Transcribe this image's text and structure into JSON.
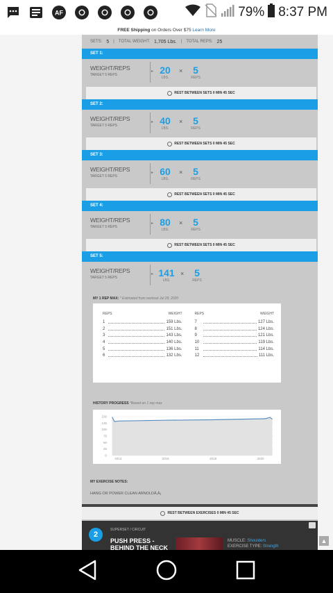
{
  "status": {
    "battery": "79%",
    "time": "8:37 PM",
    "notif_badge": "AF"
  },
  "promo": {
    "bold": "FREE Shipping",
    "text": " on Orders Over $75 ",
    "link": "Learn More"
  },
  "summary": {
    "sets_label": "SETS:",
    "sets": "5",
    "weight_label": "TOTAL WEIGHT:",
    "weight": "1,705 Lbs.",
    "reps_label": "TOTAL REPS:",
    "reps": "25"
  },
  "sets": [
    {
      "header": "SET 1:",
      "label": "WEIGHT/REPS",
      "target": "TARGET 5 REPS",
      "weight": "20",
      "reps": "5",
      "rest": "REST BETWEEN SETS 0 MIN 45 SEC"
    },
    {
      "header": "SET 2:",
      "label": "WEIGHT/REPS",
      "target": "TARGET 5 REPS",
      "weight": "40",
      "reps": "5",
      "rest": "REST BETWEEN SETS 0 MIN 45 SEC"
    },
    {
      "header": "SET 3:",
      "label": "WEIGHT/REPS",
      "target": "TARGET 5 REPS",
      "weight": "60",
      "reps": "5",
      "rest": "REST BETWEEN SETS 0 MIN 45 SEC"
    },
    {
      "header": "SET 4:",
      "label": "WEIGHT/REPS",
      "target": "TARGET 5 REPS",
      "weight": "80",
      "reps": "5",
      "rest": "REST BETWEEN SETS 0 MIN 45 SEC"
    },
    {
      "header": "SET 5:",
      "label": "WEIGHT/REPS",
      "target": "TARGET 5 REPS",
      "weight": "141",
      "reps": "5"
    }
  ],
  "units": {
    "lbs": "LBS.",
    "reps": "REPS",
    "times": "×"
  },
  "one_rep_max": {
    "title": "MY 1 REP MAX:",
    "note": " * Estimated from workout ",
    "date": "Jul 29, 2020",
    "hd_reps": "REPS",
    "hd_weight": "WEIGHT",
    "left": [
      [
        "1",
        "159 Lbs."
      ],
      [
        "2",
        "151 Lbs."
      ],
      [
        "3",
        "143 Lbs."
      ],
      [
        "4",
        "140 Lbs."
      ],
      [
        "5",
        "136 Lbs."
      ],
      [
        "6",
        "132 Lbs."
      ]
    ],
    "right": [
      [
        "7",
        "127 Lbs."
      ],
      [
        "8",
        "124 Lbs."
      ],
      [
        "9",
        "121 Lbs."
      ],
      [
        "10",
        "119 Lbs."
      ],
      [
        "11",
        "114 Lbs."
      ],
      [
        "12",
        "111 Lbs."
      ]
    ]
  },
  "history": {
    "title": "HISTORY PROGRESS",
    "note": " *Based on 1 rep max"
  },
  "chart_data": {
    "type": "area",
    "title": "",
    "xlabel": "",
    "ylabel": "",
    "y_ticks": [
      0,
      25,
      50,
      75,
      100,
      125,
      150
    ],
    "x_ticks": [
      "2014",
      "2016",
      "2018",
      "2020"
    ],
    "ylim": [
      0,
      150
    ],
    "series": [
      {
        "points": [
          [
            2013.75,
            148
          ],
          [
            2013.85,
            131
          ],
          [
            2014.0,
            133
          ],
          [
            2016.0,
            136
          ],
          [
            2018.0,
            138
          ],
          [
            2020.2,
            142
          ],
          [
            2020.4,
            147
          ],
          [
            2020.5,
            140
          ]
        ]
      }
    ],
    "colors": {
      "line": "#5a8fc0",
      "fill": "#e2e2e2"
    }
  },
  "notes": {
    "title": "MY EXERCISE NOTES:",
    "text": "HANG OR POWER CLEAN ARNOLDÂ‚Â¡"
  },
  "rest_exercises": "REST BETWEEN EXERCISES 0 MIN 45 SEC",
  "next": {
    "number": "2",
    "tag": "SUPERSET / CIRCUIT",
    "name": "PUSH PRESS - BEHIND THE NECK",
    "muscle_label": "MUSCLE:",
    "muscle": "Shoulders",
    "type_label": "EXERCISE TYPE:",
    "type": "Strength"
  },
  "icons": {
    "back": "back-triangle-icon",
    "home": "home-circle-icon",
    "recents": "recents-square-icon"
  }
}
